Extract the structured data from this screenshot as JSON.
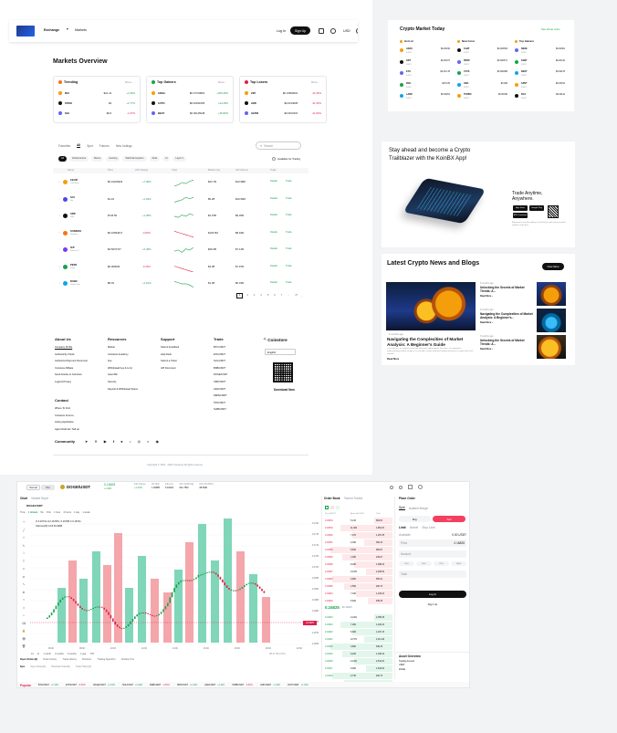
{
  "nav": {
    "exchange": "Exchange",
    "markets": "Markets",
    "login": "Log In",
    "signup": "Sign Up",
    "currency": "USD"
  },
  "overview": {
    "title": "Markets Overview",
    "more": "More",
    "panels": [
      {
        "title": "Trending",
        "rows": [
          [
            "ZEC",
            "$21.41",
            "+4.49%"
          ],
          [
            "ATOM",
            "$4",
            "+2.77%"
          ],
          [
            "AVA",
            "$6.6",
            "-1.07%"
          ]
        ]
      },
      {
        "title": "Top Gainers",
        "rows": [
          [
            "ANOA",
            "$0.07720891",
            "+306.28%"
          ],
          [
            "AUTO",
            "$0.02331665",
            "+44.28%"
          ],
          [
            "BEAT",
            "$0.00115048",
            "+35.80%"
          ]
        ]
      },
      {
        "title": "Top Losers",
        "rows": [
          [
            "VXP",
            "$0.13560001",
            "-32.46%"
          ],
          [
            "LMR",
            "$0.0134605",
            "-31.05%"
          ],
          [
            "HAPM",
            "$0.0153415",
            "-21.83%"
          ]
        ]
      }
    ]
  },
  "table": {
    "tabs": [
      "Favorites",
      "All",
      "Spot",
      "Futures",
      "New Listings"
    ],
    "search_placeholder": "Search",
    "chips": [
      "All",
      "Infrastructure",
      "Meme",
      "Gaming",
      "Web3 Ecosystem",
      "Real",
      "AI",
      "Layer 1"
    ],
    "available_label": "Available for Trading",
    "headers": [
      "Name",
      "Price",
      "24h Change",
      "Chart",
      "Market Cap",
      "24h Volume",
      "Trade"
    ],
    "rows": [
      {
        "sym": "CEUR",
        "sub": "Celo Euro",
        "price": "$0.16229929",
        "chg": "+7.99%",
        "cap": "$23.7M",
        "vol": "$10.98M"
      },
      {
        "sym": "SUI",
        "sub": "Sui",
        "price": "$1.91",
        "chg": "+1.63%",
        "cap": "$5.2B",
        "vol": "$10.59M"
      },
      {
        "sym": "XRP",
        "sub": "XRP",
        "price": "$744.56",
        "chg": "+1.28%",
        "cap": "$2.97B",
        "vol": "$9.36M"
      },
      {
        "sym": "SUNDOG",
        "sub": "Sundog",
        "price": "$0.10594617",
        "chg": "-0.82%",
        "cap": "$103.5M",
        "vol": "$8.94M"
      },
      {
        "sym": "ICP",
        "sub": "Internet C.",
        "price": "$3.5072747",
        "chg": "+0.48%",
        "cap": "$28.4B",
        "vol": "$7.14M"
      },
      {
        "sym": "PEPE",
        "sub": "Pepe",
        "price": "$0.000006",
        "chg": "-0.46%",
        "cap": "$3.3B",
        "vol": "$7.97M"
      },
      {
        "sym": "DUBC",
        "sub": "Dubai Coin",
        "price": "$8.45",
        "chg": "+1.61%",
        "cap": "$1.4B",
        "vol": "$6.33M"
      }
    ],
    "details": "Details",
    "trade": "Trade",
    "pages": [
      "1",
      "2",
      "3",
      "4",
      "5",
      "6",
      "7",
      "...",
      "27"
    ]
  },
  "footer": {
    "cols": [
      {
        "title": "About Us",
        "items": [
          "Company Profile",
          "Authenticity Check",
          "Authorized Payment Personnel",
          "Coinstore Affiliate",
          "Send Articles to Coinstore",
          "Legal & Privacy"
        ]
      },
      {
        "title": "Resources",
        "items": [
          "Market",
          "Coinstore Academy",
          "Fee",
          "Withdrawal Fee & Limit",
          "Asset Bin",
          "Security",
          "Deposit & Withdrawal Status"
        ]
      },
      {
        "title": "Support",
        "items": [
          "Submit Feedback",
          "Help Desk",
          "Submit a Ticket",
          "API Document"
        ]
      },
      {
        "title": "Trade",
        "items": [
          "BTC/USDT",
          "ETH/USDT",
          "SOL/USDT",
          "BNB/USDT",
          "DOGE/USDT",
          "XRP/USDT",
          "ADA/USDT",
          "PEPE/USDT",
          "TRX/USDT",
          "SHIB/USDT"
        ]
      }
    ],
    "contact_title": "Contact",
    "contact": [
      "Where To Find",
      "Coinstore Forums",
      "Listing Application",
      "Agent Referral / Sell-up"
    ],
    "brand": "Coinstore",
    "lang": "English",
    "download": "Download Now",
    "community": "Community",
    "copyright": "Copyright © 2021 - 2024 Coinstore All rights reserved"
  },
  "today": {
    "title": "Crypto Market Today",
    "see_all": "See all top coins",
    "cols": [
      {
        "title": "Hot List",
        "rows": [
          [
            "ADAS",
            "$0.00016"
          ],
          [
            "ORT",
            "$0.00071"
          ],
          [
            "ETH",
            "$3,410.15"
          ],
          [
            "BCH",
            "$476.05"
          ],
          [
            "LABR",
            "$0.03251"
          ]
        ]
      },
      {
        "title": "New Coins",
        "rows": [
          [
            "CHAT",
            "$0.003354"
          ],
          [
            "PROP",
            "$0.000571"
          ],
          [
            "CTVS",
            "$0.000068"
          ],
          [
            "OBA",
            "$0.036"
          ],
          [
            "TURBO",
            "$0.00049"
          ]
        ]
      },
      {
        "title": "Top Gainers",
        "rows": [
          [
            "NEOE",
            "$0.00061"
          ],
          [
            "KNST",
            "$0.00142"
          ],
          [
            "NEOT",
            "$0.09178"
          ],
          [
            "GRVT",
            "$0.03154"
          ],
          [
            "RCA",
            "$0.00112"
          ]
        ]
      }
    ]
  },
  "promo": {
    "title": "Stay ahead and become a Crypto Trailblazer with the KoinBX App!",
    "tagline": "Trade Anytime, Anywhere.",
    "store1": "App Store",
    "store2": "Google Play",
    "store3": "APK Download",
    "note": "Experience smooth trading on all devices with instant market updates and alerts"
  },
  "news": {
    "title": "Latest Crypto News and Blogs",
    "view_more": "View More",
    "main_meta": "6 months ago",
    "main_title": "Navigating the Complexities of Market Analysis: A Beginner's Guide",
    "main_body": "The market is a complex landscape filled with opportunities and risks. For beginners, understanding market analysis is essential to make informed trading decisions in crypto and stock markets.",
    "read_more": "Read More",
    "items": [
      {
        "meta": "6 months ago",
        "title": "Unlocking the Secrets of Market Trends: A..."
      },
      {
        "meta": "6 months ago",
        "title": "Navigating the Complexities of Market Analysis: A Beginner's..."
      },
      {
        "meta": "6 months ago",
        "title": "Unlocking the Secrets of Market Trends: A..."
      }
    ]
  },
  "trading": {
    "modes": [
      "Normal",
      "Pro"
    ],
    "pair": "DOGE/USDT",
    "last": "0.16825",
    "last_sub": "+1.34%",
    "stats": [
      [
        "24h Change",
        "+1.34%"
      ],
      [
        "24h High",
        "0.16985"
      ],
      [
        "24h Low",
        "0.16620"
      ],
      [
        "24h Vol(DOGE)",
        "231.75M"
      ],
      [
        "24h Vol(USDT)",
        "38.59M"
      ]
    ],
    "chart_tabs": [
      "Chart",
      "Market Depth"
    ],
    "intervals": [
      "Time",
      "1 minute",
      "5m",
      "15m",
      "1 hour",
      "4 hours",
      "1 day",
      "1 week"
    ],
    "ohlc": "O 0.16713 H 0.16725 L 0.16708 C 0.16721",
    "vol": "Volume(20) 13.8 26.2968",
    "y_labels": [
      "0.1720",
      "0.1715",
      "0.1710",
      "0.1705",
      "0.1700",
      "0.1695",
      "0.1690",
      "0.1685",
      "0.1680",
      "0.1675",
      "0.1670",
      "0.1665"
    ],
    "price_tag": "0.16825",
    "x_labels": [
      "06:00",
      "08:00",
      "10:00",
      "12:00",
      "14:00",
      "16:00",
      "18:00",
      "20:00",
      "22:00"
    ],
    "ranges": [
      "1d",
      "5d",
      "1 month",
      "3 months",
      "6 months",
      "1 year",
      "YTD"
    ],
    "utc": "08:17:48 (UTC)",
    "orderbook_title": "Order Book",
    "recent_title": "Recent Trades",
    "ob_headers": [
      "Price(USDT)",
      "Amount(DOGE)",
      "Total"
    ],
    "asks": [
      [
        "0.16834",
        "5,130",
        "863.60"
      ],
      [
        "0.16833",
        "11,000",
        "1,851.63"
      ],
      [
        "0.16832",
        "7,470",
        "1,257.35"
      ],
      [
        "0.16831",
        "2,330",
        "392.16"
      ],
      [
        "0.16830",
        "5,840",
        "982.87"
      ],
      [
        "0.16829",
        "1,480",
        "249.07"
      ],
      [
        "0.16828",
        "8,250",
        "1,388.31"
      ],
      [
        "0.16827",
        "13,630",
        "2,293.52"
      ],
      [
        "0.16826",
        "3,900",
        "656.21"
      ],
      [
        "0.16825",
        "1,550",
        "260.79"
      ],
      [
        "0.16824",
        "7,330",
        "1,233.20"
      ],
      [
        "0.16823",
        "5,620",
        "945.45"
      ]
    ],
    "mid": "0.16825",
    "mid_sub": "$0.16825",
    "bids": [
      [
        "0.16824",
        "14,000",
        "2,355.36"
      ],
      [
        "0.16823",
        "7,290",
        "1,226.40"
      ],
      [
        "0.16822",
        "8,900",
        "1,497.16"
      ],
      [
        "0.16821",
        "12,570",
        "2,114.40"
      ],
      [
        "0.16820",
        "3,800",
        "639.16"
      ],
      [
        "0.16819",
        "6,220",
        "1,046.14"
      ],
      [
        "0.16818",
        "14,940",
        "2,512.61"
      ],
      [
        "0.16817",
        "9,060",
        "1,523.62"
      ],
      [
        "0.16816",
        "2,740",
        "460.76"
      ],
      [
        "0.16815",
        "7,510",
        "1,262.81"
      ]
    ],
    "place_order": "Place Order",
    "order_types": [
      "Spot",
      "Isolated Margin"
    ],
    "buy": "Buy",
    "sell": "Sell",
    "limit": "Limit",
    "market": "Market",
    "stop": "Stop Limit",
    "avbl": "Available",
    "avbl_val": "0.00 USDT",
    "price_label": "Price",
    "price_val": "0.16825",
    "amount_label": "Amount",
    "pcts": [
      "25%",
      "50%",
      "75%",
      "100%"
    ],
    "total_label": "Total",
    "login_btn": "Log In",
    "signup_btn": "Sign Up",
    "assets_title": "Asset Overview",
    "assets_rows": [
      "Trading Account",
      "USDT",
      "DOGE"
    ],
    "bottom_tabs": [
      "Open Orders(0)",
      "Order History",
      "Trade History",
      "Positions",
      "Trading Algorithm",
      "Position PnL"
    ],
    "bottom_filters": [
      "Spot",
      "Open Orders(0)",
      "Historical Orders(0)",
      "Trade History(0)"
    ],
    "ticker_label": "Popular",
    "ticker": [
      "BTC/USDT",
      "ETH/USDT",
      "DOGE/USDT",
      "SOL/USDT",
      "BNB/USDT",
      "XRP/USDT",
      "ADA/USDT",
      "SHIB/USDT",
      "LINK/USDT",
      "DOT/USDT"
    ]
  },
  "colors": {
    "green": "#16a34a",
    "red": "#e11d48",
    "candle_up": "#79d3b5",
    "candle_down": "#f2a3a8",
    "dark": "#111111"
  }
}
